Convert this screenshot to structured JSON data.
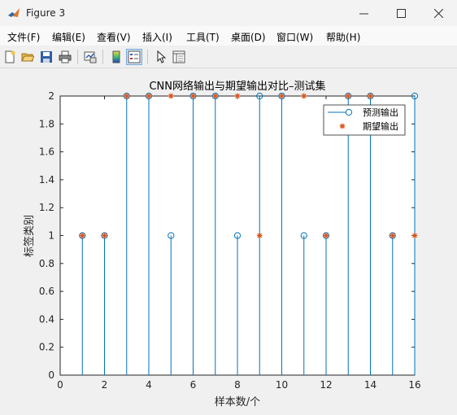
{
  "window": {
    "title": "Figure 3"
  },
  "menu": [
    "文件(F)",
    "编辑(E)",
    "查看(V)",
    "插入(I)",
    "工具(T)",
    "桌面(D)",
    "窗口(W)",
    "帮助(H)"
  ],
  "toolbar": [
    "new-figure",
    "open-file",
    "save-figure",
    "print-figure",
    "link-plot",
    "insert-colorbar",
    "insert-legend",
    "edit-plot",
    "property-inspector"
  ],
  "chart_data": {
    "type": "stem",
    "title": "CNN网络输出与期望输出对比–测试集",
    "xlabel": "样本数/个",
    "ylabel": "标签类别",
    "xlim": [
      0,
      16
    ],
    "ylim": [
      0,
      2
    ],
    "xticks": [
      "0",
      "2",
      "4",
      "6",
      "8",
      "10",
      "12",
      "14",
      "16"
    ],
    "yticks": [
      "0",
      "0.2",
      "0.4",
      "0.6",
      "0.8",
      "1",
      "1.2",
      "1.4",
      "1.6",
      "1.8",
      "2"
    ],
    "x": [
      1,
      2,
      3,
      4,
      5,
      6,
      7,
      8,
      9,
      10,
      11,
      12,
      13,
      14,
      15,
      16
    ],
    "series": [
      {
        "name": "预测输出",
        "marker": "o",
        "color": "#0072bd",
        "values": [
          1,
          1,
          2,
          2,
          1,
          2,
          2,
          1,
          2,
          2,
          1,
          1,
          2,
          2,
          1,
          2
        ]
      },
      {
        "name": "期望输出",
        "marker": "*",
        "color": "#d95319",
        "values": [
          1,
          1,
          2,
          2,
          2,
          2,
          2,
          2,
          1,
          2,
          2,
          1,
          2,
          2,
          1,
          1
        ]
      }
    ],
    "legend": "top-right"
  }
}
